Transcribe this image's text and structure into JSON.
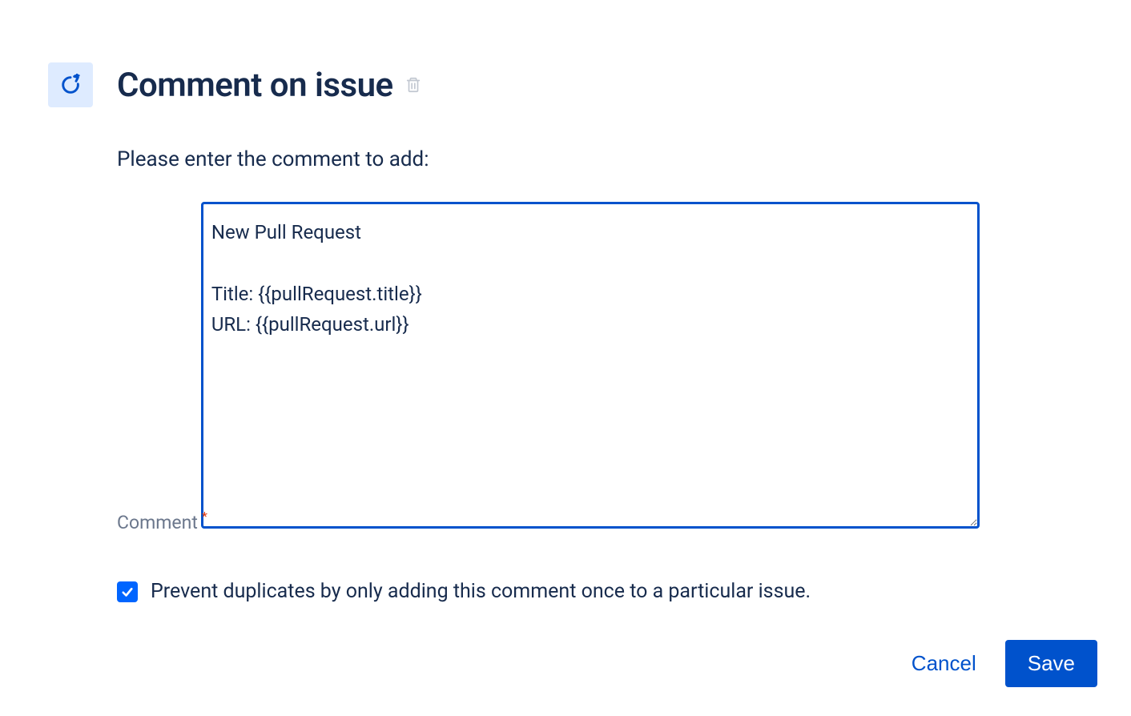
{
  "header": {
    "title": "Comment on issue"
  },
  "form": {
    "subtitle": "Please enter the comment to add:",
    "comment_label": "Comment",
    "comment_value": "New Pull Request\n\nTitle: {{pullRequest.title}}\nURL: {{pullRequest.url}}",
    "checkbox_label": "Prevent duplicates by only adding this comment once to a particular issue.",
    "checkbox_checked": true
  },
  "buttons": {
    "cancel": "Cancel",
    "save": "Save"
  }
}
